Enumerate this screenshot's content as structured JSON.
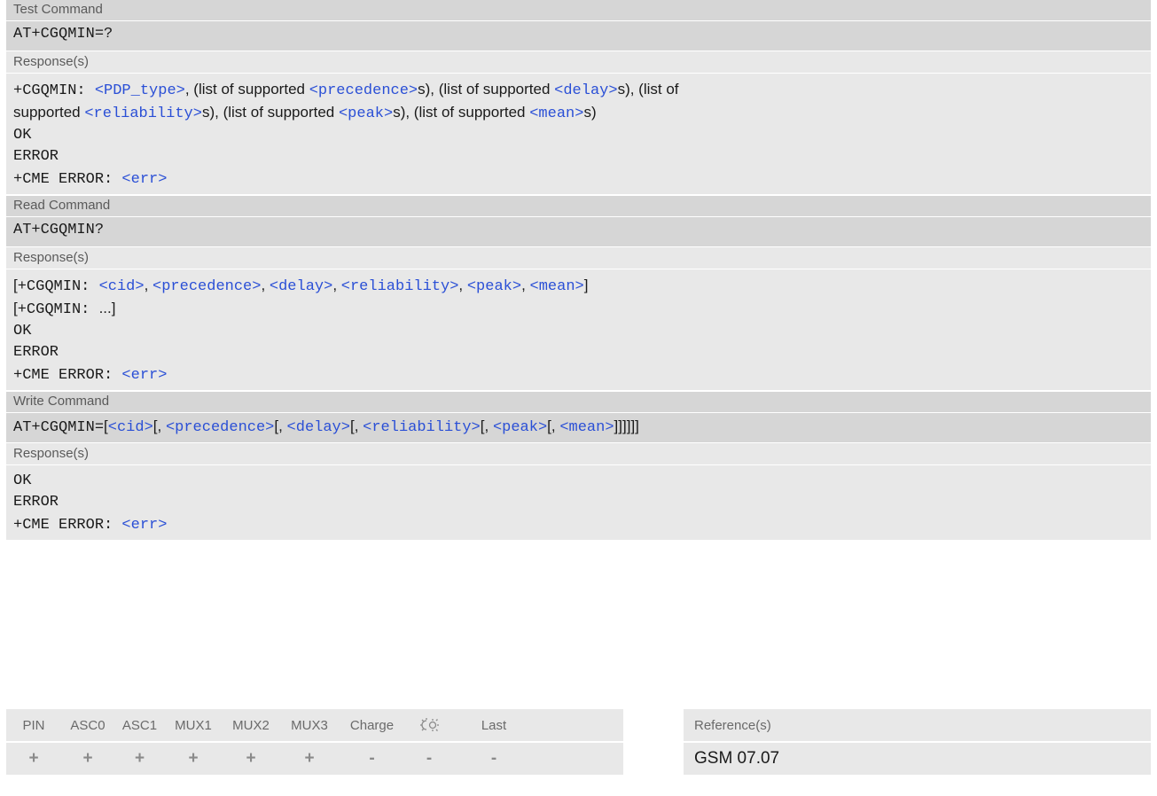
{
  "test": {
    "header": "Test Command",
    "command": "AT+CGQMIN=?",
    "response_header": "Response(s)",
    "resp1_prefix": "+CGQMIN: ",
    "p_pdp_type": "<PDP_type>",
    "t_list_precedence": ", (list of supported ",
    "p_precedence": "<precedence>",
    "t_list_delay": "s), (list of supported ",
    "p_delay": "<delay>",
    "t_list_of": "s), (list of",
    "t_supported": "supported ",
    "p_reliability": "<reliability>",
    "t_list_peak": "s), (list of supported ",
    "p_peak": "<peak>",
    "t_list_mean": "s), (list of supported ",
    "p_mean": "<mean>",
    "t_end": "s)",
    "ok": "OK",
    "error": "ERROR",
    "cme_prefix": "+CME ERROR: ",
    "p_err": "<err>"
  },
  "read": {
    "header": "Read Command",
    "command": "AT+CGQMIN?",
    "response_header": "Response(s)",
    "open_bracket": "[",
    "resp1_prefix": "+CGQMIN: ",
    "p_cid": "<cid>",
    "sep": ", ",
    "p_precedence": "<precedence>",
    "p_delay": "<delay>",
    "p_reliability": "<reliability>",
    "p_peak": "<peak>",
    "p_mean": "<mean>",
    "close_bracket": "]",
    "resp2_prefix": "+CGQMIN: ",
    "ellipsis": "...",
    "ok": "OK",
    "error": "ERROR",
    "cme_prefix": "+CME ERROR: ",
    "p_err": "<err>"
  },
  "write": {
    "header": "Write Command",
    "command_prefix": "AT+CGQMIN=",
    "b1": "[",
    "p_cid": "<cid>",
    "b2": "[, ",
    "p_precedence": "<precedence>",
    "p_delay": "<delay>",
    "p_reliability": "<reliability>",
    "p_peak": "<peak>",
    "p_mean": "<mean>",
    "close": "]]]]]]",
    "response_header": "Response(s)",
    "ok": "OK",
    "error": "ERROR",
    "cme_prefix": "+CME ERROR: ",
    "p_err": "<err>"
  },
  "footer": {
    "columns": [
      "PIN",
      "ASC0",
      "ASC1",
      "MUX1",
      "MUX2",
      "MUX3",
      "Charge",
      "☀",
      "Last"
    ],
    "values": [
      "+",
      "+",
      "+",
      "+",
      "+",
      "+",
      "-",
      "-",
      "-"
    ],
    "reference_header": "Reference(s)",
    "reference_value": "GSM 07.07"
  }
}
